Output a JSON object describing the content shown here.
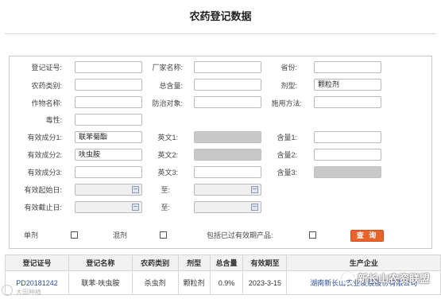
{
  "page": {
    "title": "农药登记数据"
  },
  "form": {
    "reg_no": {
      "label": "登记证号:",
      "value": ""
    },
    "manufacturer": {
      "label": "厂家名称:",
      "value": ""
    },
    "province": {
      "label": "省份:",
      "value": ""
    },
    "pesticide_type": {
      "label": "农药类别:",
      "value": ""
    },
    "total_content": {
      "label": "总含量:",
      "value": ""
    },
    "formulation": {
      "label": "剂型:",
      "value": "颗粒剂"
    },
    "crop": {
      "label": "作物名称:",
      "value": ""
    },
    "target": {
      "label": "防治对象:",
      "value": ""
    },
    "usage": {
      "label": "施用方法:",
      "value": ""
    },
    "toxicity": {
      "label": "毒性:",
      "value": ""
    },
    "ingredient1": {
      "label": "有效成分1:",
      "value": "联苯菊酯",
      "en_label": "英文1:",
      "content_label": "含量1:"
    },
    "ingredient2": {
      "label": "有效成分2:",
      "value": "呋虫胺",
      "en_label": "英文2:",
      "content_label": "含量2:"
    },
    "ingredient3": {
      "label": "有效成分3:",
      "value": "",
      "en_label": "英文3:",
      "content_label": "含量3:"
    },
    "valid_start": {
      "label": "有效起始日:",
      "to_label": "至:"
    },
    "valid_end": {
      "label": "有效截止日:",
      "to_label": "至:"
    },
    "single": {
      "label": "单剂"
    },
    "mixed": {
      "label": "混剂"
    },
    "include_expired": {
      "label": "包括已过有效期产品:"
    },
    "query_button": "查 询"
  },
  "table": {
    "headers": [
      "登记证号",
      "登记名称",
      "农药类别",
      "剂型",
      "总含量",
      "有效期至",
      "生产企业"
    ],
    "rows": [
      [
        "PD20181242",
        "联苯·呋虫胺",
        "杀虫剂",
        "颗粒剂",
        "0.9%",
        "2023-3-15",
        "湖南新长山农业发展股份有限公司"
      ]
    ]
  },
  "watermarks": {
    "left": "大田种植",
    "right": "新长山农资联盟"
  }
}
